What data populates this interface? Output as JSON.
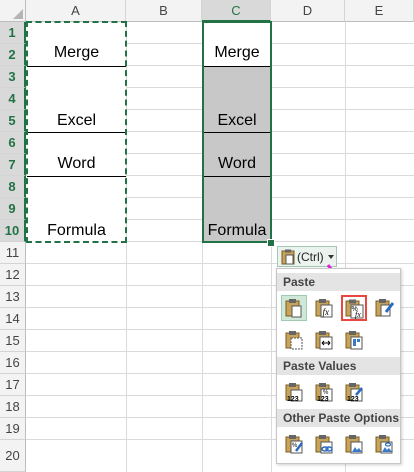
{
  "columns": [
    "A",
    "B",
    "C",
    "D",
    "E"
  ],
  "rows": [
    "1",
    "2",
    "3",
    "4",
    "5",
    "6",
    "7",
    "8",
    "9",
    "10",
    "11",
    "12",
    "13",
    "14",
    "15",
    "16",
    "17",
    "18",
    "19",
    "20"
  ],
  "column_a": {
    "merge": "Merge",
    "excel": "Excel",
    "word": "Word",
    "formula": "Formula"
  },
  "column_c": {
    "merge": "Merge",
    "excel": "Excel",
    "word": "Word",
    "formula": "Formula"
  },
  "paste_button": {
    "label": "(Ctrl)",
    "icon": "clipboard-icon",
    "dropdown_icon": "caret-down-icon"
  },
  "paste_menu": {
    "section_paste": "Paste",
    "section_paste_values": "Paste Values",
    "section_other": "Other Paste Options",
    "values_badge": "123",
    "percent_symbol": "%",
    "fx_symbol": "fx"
  },
  "colors": {
    "accent": "#217346",
    "selected_gray": "#c8c8c8",
    "highlight_box": "#e8473f",
    "arrow": "#e81ee0"
  }
}
